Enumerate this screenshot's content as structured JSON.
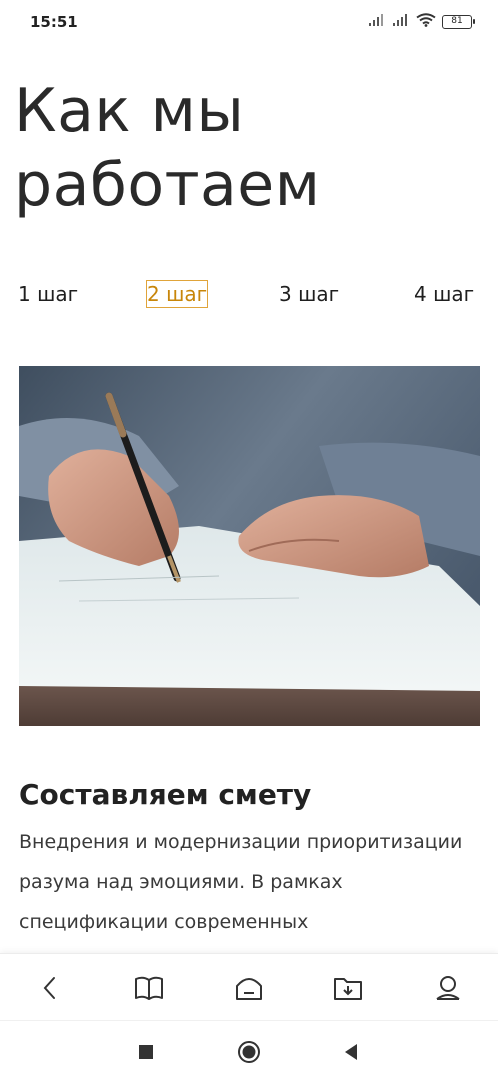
{
  "status_bar": {
    "time": "15:51",
    "battery": "81",
    "icons": [
      "signal-icon",
      "signal-icon",
      "wifi-icon",
      "battery-icon"
    ]
  },
  "page": {
    "title": "Как мы работаем"
  },
  "steps": [
    {
      "label": "1 шаг",
      "active": false
    },
    {
      "label": "2 шаг",
      "active": true
    },
    {
      "label": "3 шаг",
      "active": false
    },
    {
      "label": "4 шаг",
      "active": false
    }
  ],
  "content": {
    "heading": "Составляем смету",
    "text": "Внедрения и модернизации приоритизации разума над эмоциями. В рамках спецификации современных"
  },
  "bottom_nav": {
    "items": [
      "back-icon",
      "book-icon",
      "home-icon",
      "download-folder-icon",
      "profile-icon"
    ]
  },
  "system_nav": {
    "items": [
      "recent-apps-icon",
      "home-circle-icon",
      "back-triangle-icon"
    ]
  },
  "colors": {
    "accent": "#c8860a",
    "text": "#1f1f1f"
  }
}
